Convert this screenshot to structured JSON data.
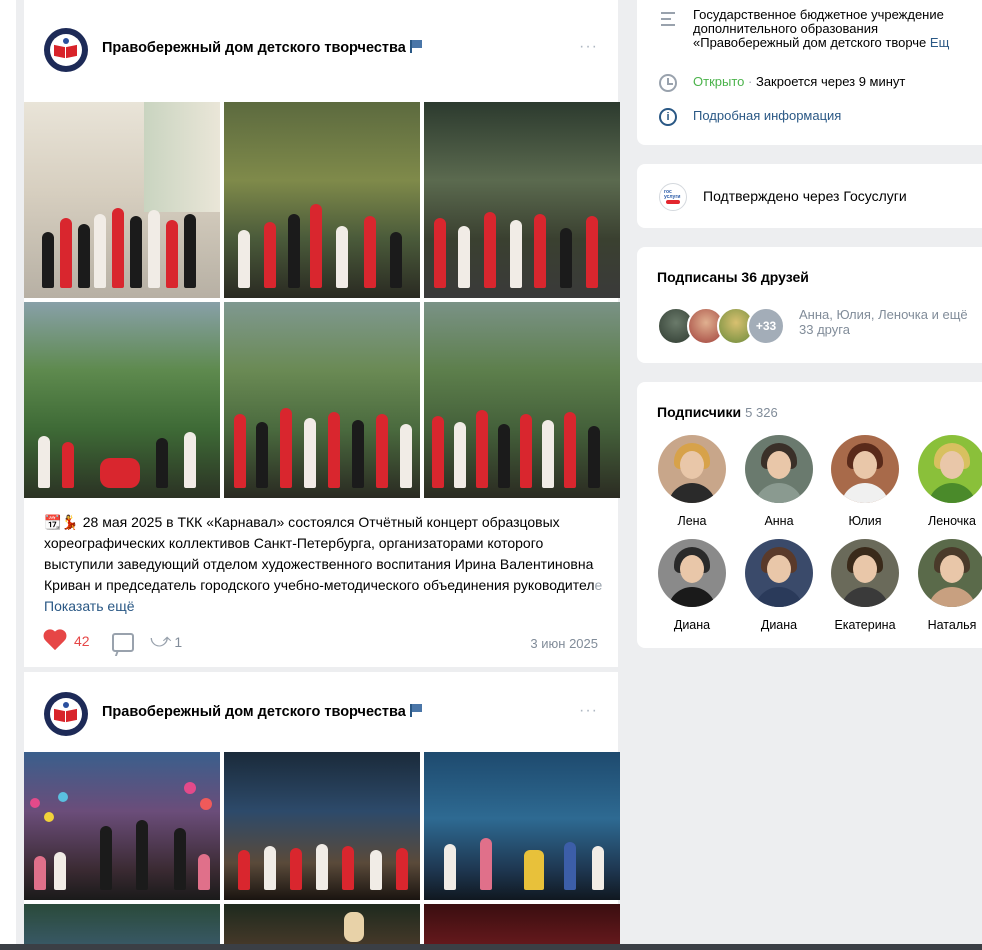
{
  "posts": [
    {
      "group_name": "Правобережный дом детского творчества",
      "more": "···",
      "text_emoji": "📆💃",
      "text": "28 мая 2025 в ТКК «Карнавал» состоялся Отчётный концерт образцовых хореографических коллективов Санкт-Петербурга, организаторами которого выступили заведующий отделом художественного воспитания Ирина Валентиновна Криван и председатель городского учебно-методического объединения руководител",
      "text_fade": "е",
      "show_more": "Показать ещё",
      "likes": "42",
      "shares": "1",
      "date": "3 июн 2025"
    },
    {
      "group_name": "Правобережный дом детского творчества",
      "more": "···"
    }
  ],
  "sidebar": {
    "info": {
      "description": [
        "Государственное бюджетное учреждение",
        "дополнительного образования",
        "«Правобережный дом детского творче"
      ],
      "description_more": "Ещ",
      "open_status": "Открыто",
      "separator": "·",
      "closes": "Закроется через 9 минут",
      "details_link": "Подробная информация"
    },
    "gos": {
      "label": "Подтверждено через Госуслуги",
      "icon_top": "гос услуги"
    },
    "friends": {
      "title": "Подписаны 36 друзей",
      "more_badge": "+33",
      "names_line1": "Анна, Юлия, Леночка и ещё",
      "names_line2": "33 друга"
    },
    "subscribers": {
      "title": "Подписчики",
      "count": "5 326",
      "people": [
        {
          "name": "Лена"
        },
        {
          "name": "Анна"
        },
        {
          "name": "Юлия"
        },
        {
          "name": "Леночка"
        },
        {
          "name": "Диана"
        },
        {
          "name": "Диана"
        },
        {
          "name": "Екатерина"
        },
        {
          "name": "Наталья"
        }
      ]
    }
  },
  "colors": {
    "accent": "#2a5885",
    "like": "#e64646",
    "open": "#4bb34b",
    "background": "#edeef0"
  }
}
